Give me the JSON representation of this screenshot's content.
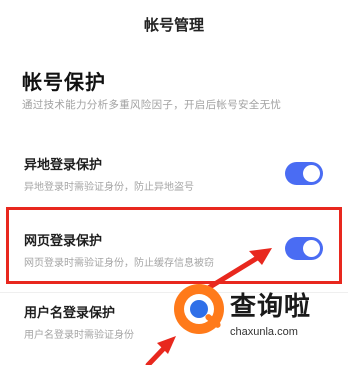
{
  "header": {
    "title": "帐号管理"
  },
  "section": {
    "title": "帐号保护",
    "description": "通过技术能力分析多重风险因子，开启后帐号安全无忧"
  },
  "rows": [
    {
      "title": "异地登录保护",
      "subtitle": "异地登录时需验证身份，防止异地盗号",
      "toggle_on": true
    },
    {
      "title": "网页登录保护",
      "subtitle": "网页登录时需验证身份，防止缓存信息被窃",
      "toggle_on": true
    },
    {
      "title": "用户名登录保护",
      "subtitle": "用户名登录时需验证身份",
      "toggle_on": true
    }
  ],
  "watermark": {
    "text": "查询啦",
    "url": "chaxunla.com"
  },
  "colors": {
    "accent": "#4a6cf3",
    "highlight": "#e8281e",
    "brand": "#ff7a1a"
  }
}
